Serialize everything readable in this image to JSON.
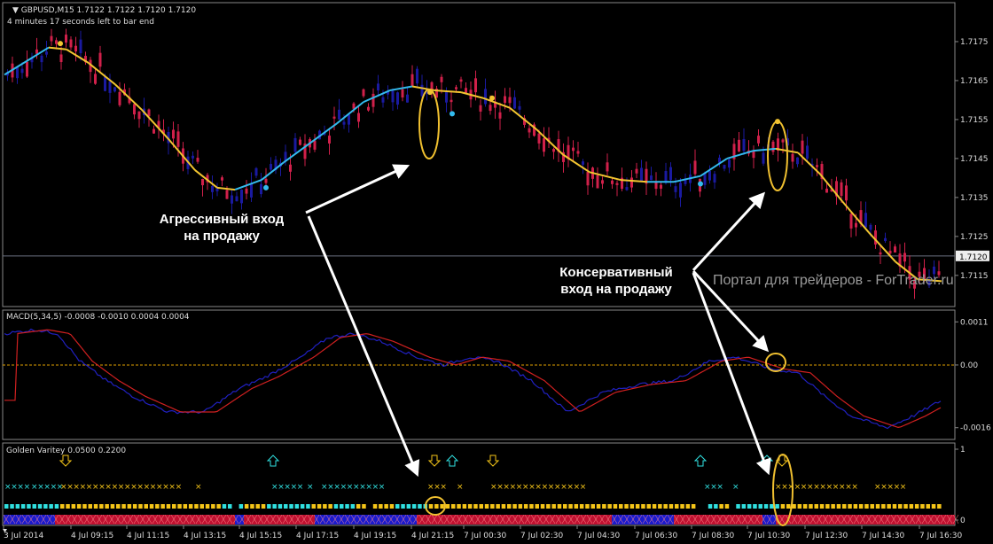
{
  "symbol_header": "GBPUSD,M15  1.7122 1.7122 1.7120 1.7120",
  "bar_timer": "4 minutes 17 seconds left to bar end",
  "price_axis": [
    "1.7175",
    "1.7165",
    "1.7155",
    "1.7145",
    "1.7135",
    "1.7125",
    "1.7115"
  ],
  "price_axis_range": [
    1.7107,
    1.7185
  ],
  "current_price": "1.7120",
  "macd_header": "MACD(5,34,5) -0.0008 -0.0010 0.0004 0.0004",
  "macd_axis": [
    "0.0011",
    "0.00",
    "-0.0016"
  ],
  "gv_header": "Golden Varitey 0.0500 0.2200",
  "gv_axis": [
    "1",
    "0"
  ],
  "time_axis": [
    "3 Jul 2014",
    "4 Jul 09:15",
    "4 Jul 11:15",
    "4 Jul 13:15",
    "4 Jul 15:15",
    "4 Jul 17:15",
    "4 Jul 19:15",
    "4 Jul 21:15",
    "7 Jul 00:30",
    "7 Jul 02:30",
    "7 Jul 04:30",
    "7 Jul 06:30",
    "7 Jul 08:30",
    "7 Jul 10:30",
    "7 Jul 12:30",
    "7 Jul 14:30",
    "7 Jul 16:30"
  ],
  "annotations": {
    "aggressive_line1": "Агрессивный вход",
    "aggressive_line2": "на продажу",
    "conservative_line1": "Консервативный",
    "conservative_line2": "вход на продажу"
  },
  "watermark": "Портал для трейдеров - ForTrader.ru",
  "colors": {
    "bull": "#1a1aa0",
    "bear": "#d0204a",
    "ma_up": "#33bbee",
    "ma_down": "#f2c530",
    "macd_main": "#2020c0",
    "macd_signal": "#d02020",
    "zero_line": "#e0a000",
    "gv_cyan": "#30e0e0",
    "gv_yellow": "#f5c518",
    "highlight": "#f0c030"
  }
}
